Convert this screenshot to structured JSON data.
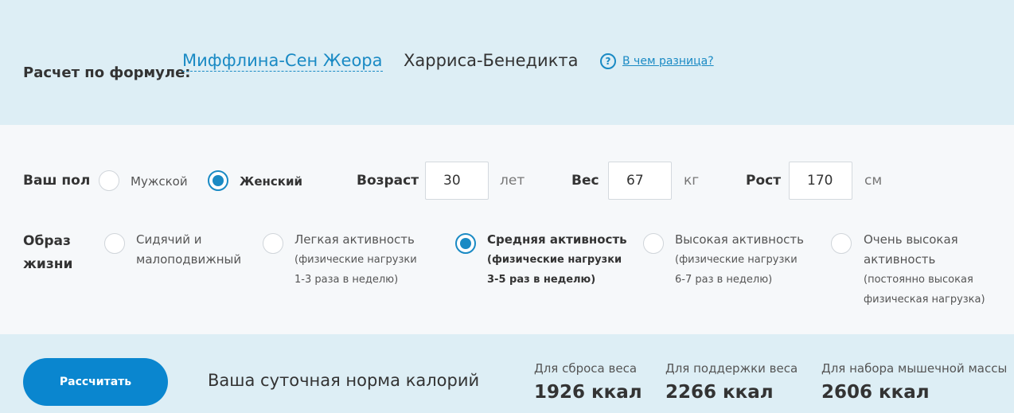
{
  "formula": {
    "label": "Расчет по формуле:",
    "tabs": [
      {
        "label": "Миффлина-Сен Жеора",
        "active": true
      },
      {
        "label": "Харриса-Бенедикта",
        "active": false
      }
    ],
    "help_icon": "question-circle-icon",
    "help_link": "В чем разница?"
  },
  "gender": {
    "label": "Ваш пол",
    "options": [
      {
        "label": "Мужской",
        "selected": false
      },
      {
        "label": "Женский",
        "selected": true
      }
    ]
  },
  "age": {
    "label": "Возраст",
    "value": "30",
    "unit": "лет"
  },
  "weight": {
    "label": "Вес",
    "value": "67",
    "unit": "кг"
  },
  "height": {
    "label": "Рост",
    "value": "170",
    "unit": "см"
  },
  "lifestyle": {
    "label_line1": "Образ",
    "label_line2": "жизни",
    "options": [
      {
        "line1": "Сидячий и",
        "line2": "малоподвижный",
        "selected": false
      },
      {
        "line1": "Легкая активность",
        "line2": "(физические нагрузки",
        "line3": "1-3 раза в неделю)",
        "selected": false
      },
      {
        "line1": "Средняя активность",
        "line2": "(физические нагрузки",
        "line3": "3-5 раз в неделю)",
        "selected": true
      },
      {
        "line1": "Высокая активность",
        "line2": "(физические нагрузки",
        "line3": "6-7 раз в неделю)",
        "selected": false
      },
      {
        "line1": "Очень высокая",
        "line2": "активность",
        "line3": "(постоянно высокая",
        "line4": "физическая нагрузка)",
        "selected": false
      }
    ]
  },
  "calculate_label": "Рассчитать",
  "daily_norm_label": "Ваша суточная норма калорий",
  "results": [
    {
      "label": "Для сброса веса",
      "value": "1926 ккал"
    },
    {
      "label": "Для поддержки веса",
      "value": "2266 ккал"
    },
    {
      "label": "Для набора мышечной массы",
      "value": "2606 ккал"
    }
  ],
  "colors": {
    "accent": "#1a8ac4",
    "button": "#0a86cf",
    "band": "#ddeef5",
    "panel": "#f6f8fa"
  }
}
